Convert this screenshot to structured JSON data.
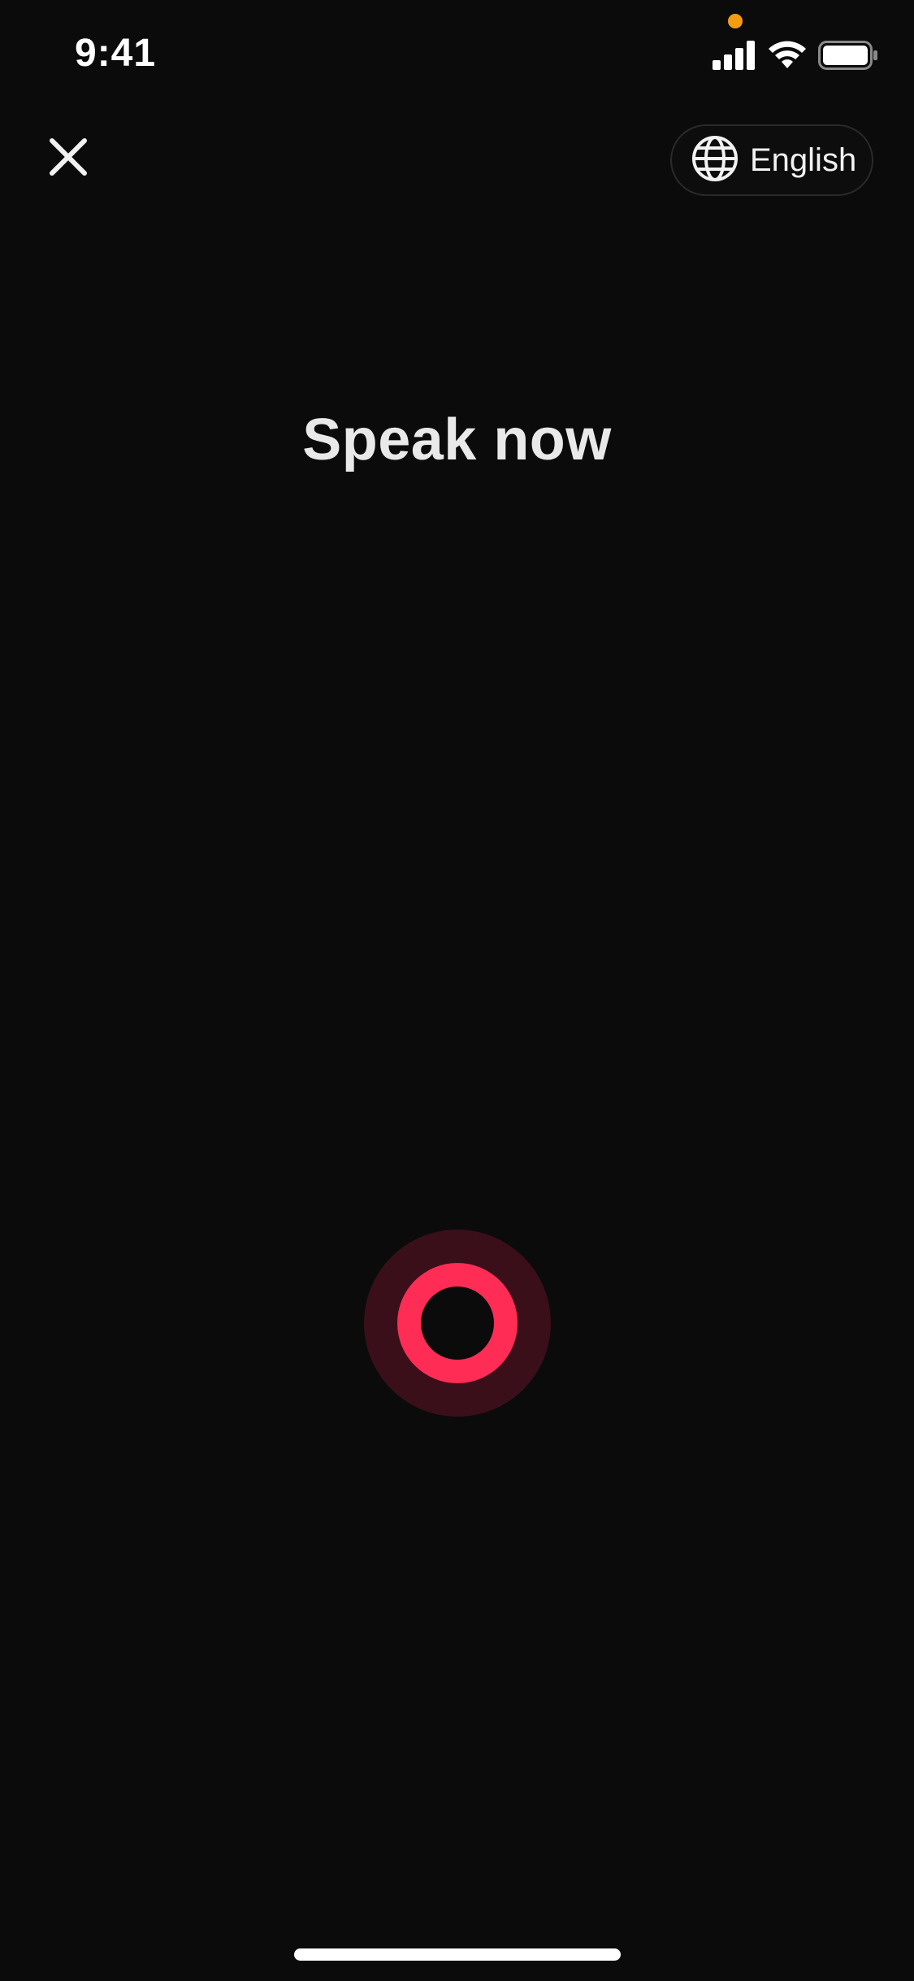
{
  "status_bar": {
    "time": "9:41",
    "privacy_indicator_color": "#f39c12",
    "icons": [
      "cellular-signal-icon",
      "wifi-icon",
      "battery-icon"
    ]
  },
  "header": {
    "close_icon": "close-icon",
    "language": {
      "icon": "globe-icon",
      "label": "English"
    }
  },
  "main": {
    "prompt": "Speak now"
  },
  "record_button": {
    "state": "listening",
    "accent_color": "#ff2d55",
    "halo_color": "#3a0f1a"
  },
  "theme": {
    "background": "#0b0b0b",
    "text": "#e9e9e9"
  }
}
